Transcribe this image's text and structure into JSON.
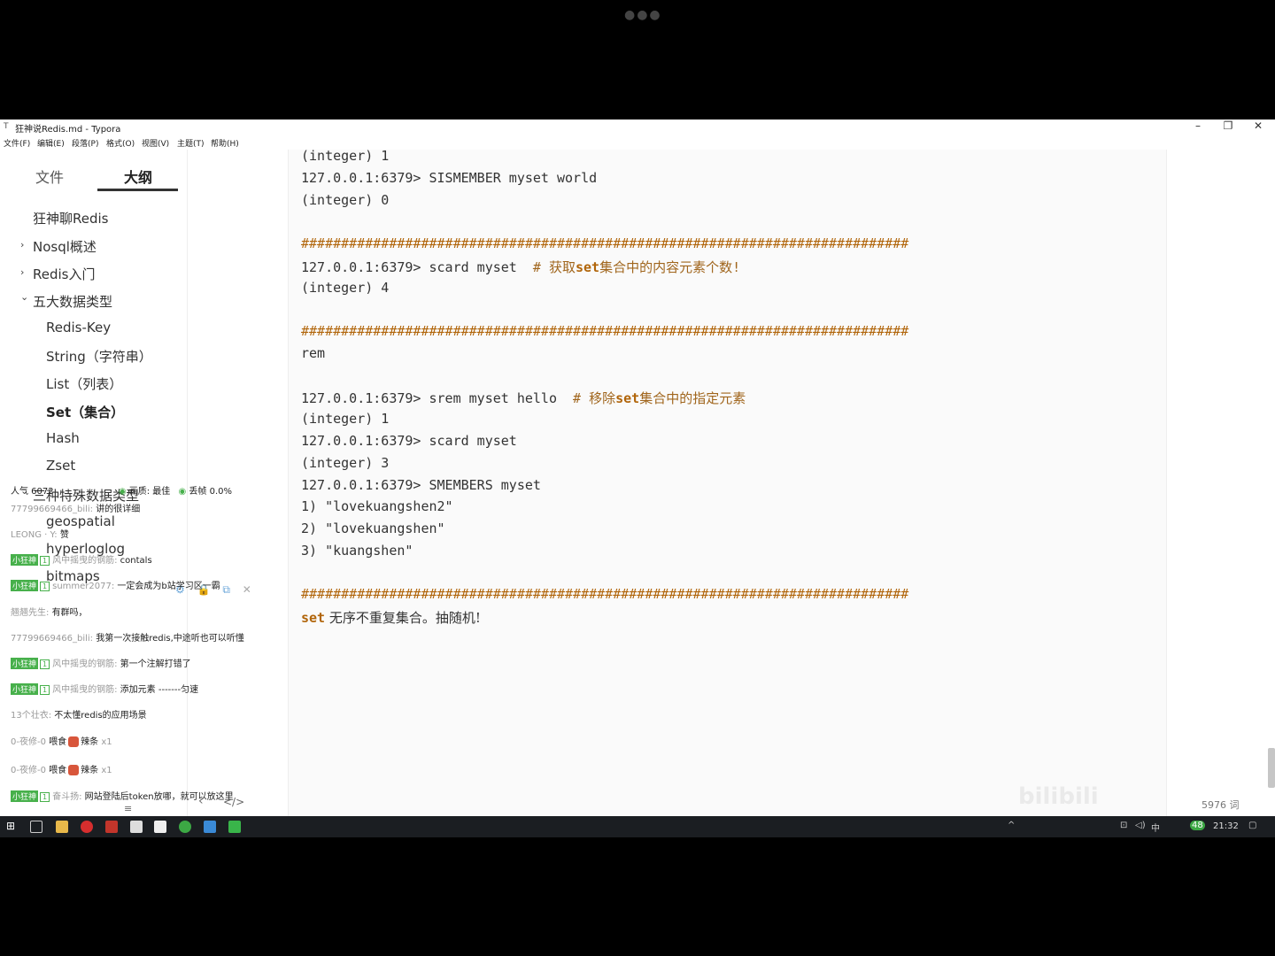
{
  "window": {
    "title": "狂神说Redis.md - Typora",
    "controls": {
      "minimize": "–",
      "maximize": "❐",
      "close": "✕"
    }
  },
  "menu": [
    "文件(F)",
    "编辑(E)",
    "段落(P)",
    "格式(O)",
    "视图(V)",
    "主题(T)",
    "帮助(H)"
  ],
  "sidebar": {
    "tabs": [
      "文件",
      "大纲"
    ],
    "outline": [
      {
        "label": "狂神聊Redis",
        "chevron": ""
      },
      {
        "label": "Nosql概述",
        "chevron": "›"
      },
      {
        "label": "Redis入门",
        "chevron": "›"
      },
      {
        "label": "五大数据类型",
        "chevron": "⌄"
      },
      {
        "label": "Redis-Key",
        "chevron": ""
      },
      {
        "label": "String（字符串）",
        "chevron": ""
      },
      {
        "label": "List（列表）",
        "chevron": ""
      },
      {
        "label": "Set（集合）",
        "chevron": ""
      },
      {
        "label": "Hash",
        "chevron": ""
      },
      {
        "label": "Zset",
        "chevron": ""
      },
      {
        "label": "三种特殊数据类型",
        "chevron": "⌄"
      },
      {
        "label": "geospatial",
        "chevron": ""
      },
      {
        "label": "hyperloglog",
        "chevron": ""
      },
      {
        "label": "bitmaps",
        "chevron": ""
      }
    ]
  },
  "editor": {
    "hash_line": "############################################################################",
    "lines": {
      "l1": "(integer) 1",
      "l2": "127.0.0.1:6379> SISMEMBER myset world",
      "l3": "(integer) 0",
      "l5a": "127.0.0.1:6379> scard myset  ",
      "l5b": "# 获取",
      "l5c": "set",
      "l5d": "集合中的内容元素个数!",
      "l6": "(integer) 4",
      "l8": "rem",
      "l9a": "127.0.0.1:6379> srem myset hello  ",
      "l9b": "# 移除",
      "l9c": "set",
      "l9d": "集合中的指定元素",
      "l10": "(integer) 1",
      "l11": "127.0.0.1:6379> scard myset",
      "l12": "(integer) 3",
      "l13": "127.0.0.1:6379> SMEMBERS myset",
      "l14": "1) \"lovekuangshen2\"",
      "l15": "2) \"lovekuangshen\"",
      "l16": "3) \"kuangshen\"",
      "l18a": "set",
      "l18b": " 无序不重复集合。抽随机!"
    }
  },
  "overlay": {
    "stats": "人气 6072",
    "quality": "画质: 最佳",
    "drop": "丢帧 0.0%"
  },
  "danmaku": [
    {
      "user": "77799669466_bili:",
      "text": "讲的很详细",
      "badge": ""
    },
    {
      "user": "LEONG · Y:",
      "text": "赞",
      "badge": ""
    },
    {
      "user": "风中摇曳的钢筋:",
      "text": "contals",
      "badge": "小狂神"
    },
    {
      "user": "summer2077:",
      "text": "一定会成为b站学习区一霸",
      "badge": "小狂神"
    },
    {
      "user": "翘翘先生:",
      "text": "有群吗，",
      "badge": ""
    },
    {
      "user": "77799669466_bili:",
      "text": "我第一次接触redis,中途听也可以听懂",
      "badge": ""
    },
    {
      "user": "风中摇曳的钢筋:",
      "text": "第一个注解打错了",
      "badge": "小狂神"
    },
    {
      "user": "风中摇曳的钢筋:",
      "text": "添加元素 -------匀速",
      "badge": "小狂神"
    },
    {
      "user": "13个壮衣:",
      "text": "不太懂redis的应用场景",
      "badge": ""
    },
    {
      "user": "0-夜修-0",
      "text": "喂食",
      "gift": "辣条",
      "count": "x1",
      "badge": ""
    },
    {
      "user": "0-夜修-0",
      "text": "喂食",
      "gift": "辣条",
      "count": "x1",
      "badge": ""
    },
    {
      "user": "奋斗扬:",
      "text": "网站登陆后token放哪，就可以放这里",
      "badge": "小狂神"
    }
  ],
  "badge_level": "1",
  "status_bar": {
    "word_count": "5976 词"
  },
  "watermark": "bilibili",
  "taskbar": {
    "clock": "21:32",
    "ime": "中",
    "battery": "48"
  }
}
